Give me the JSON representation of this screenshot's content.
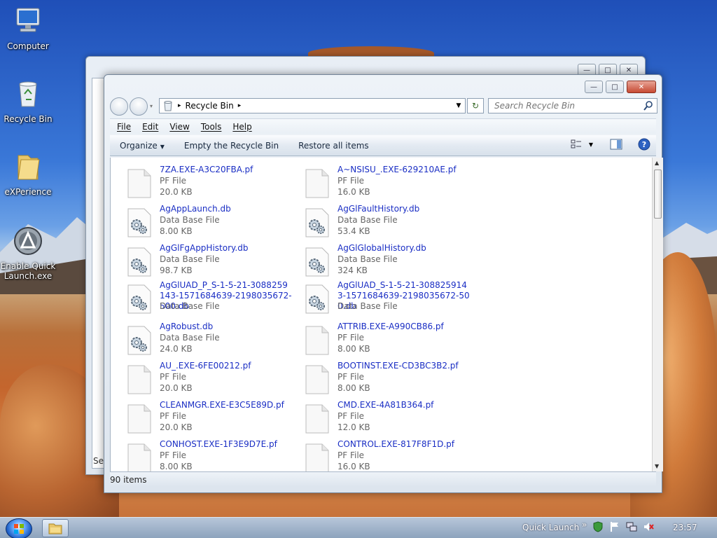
{
  "desktop": {
    "icons": [
      {
        "label": "Computer",
        "icon": "computer-icon"
      },
      {
        "label": "Recycle Bin",
        "icon": "recycle-bin-icon"
      },
      {
        "label": "eXPerience",
        "icon": "folder-icon"
      },
      {
        "label": "Enable Quick Launch.exe",
        "icon": "app-icon"
      }
    ]
  },
  "back_window": {
    "search_stub": "Sea"
  },
  "window": {
    "address": {
      "location": "Recycle Bin"
    },
    "search": {
      "placeholder": "Search Recycle Bin"
    },
    "menu": [
      "File",
      "Edit",
      "View",
      "Tools",
      "Help"
    ],
    "commands": {
      "organize": "Organize",
      "empty": "Empty the Recycle Bin",
      "restore": "Restore all items"
    },
    "status": "90 items",
    "files": [
      {
        "name": "7ZA.EXE-A3C20FBA.pf",
        "type": "PF File",
        "size": "20.0 KB",
        "kind": "pf"
      },
      {
        "name": "A~NSISU_.EXE-629210AE.pf",
        "type": "PF File",
        "size": "16.0 KB",
        "kind": "pf"
      },
      {
        "name": "AgAppLaunch.db",
        "type": "Data Base File",
        "size": "8.00 KB",
        "kind": "db"
      },
      {
        "name": "AgGlFaultHistory.db",
        "type": "Data Base File",
        "size": "53.4 KB",
        "kind": "db"
      },
      {
        "name": "AgGlFgAppHistory.db",
        "type": "Data Base File",
        "size": "98.7 KB",
        "kind": "db"
      },
      {
        "name": "AgGlGlobalHistory.db",
        "type": "Data Base File",
        "size": "324 KB",
        "kind": "db"
      },
      {
        "name": "AgGlUAD_P_S-1-5-21-3088259143-1571684639-2198035672-500.db",
        "type": "Data Base File",
        "size": "",
        "kind": "db"
      },
      {
        "name": "AgGlUAD_S-1-5-21-3088259143-1571684639-2198035672-500.db",
        "type": "Data Base File",
        "size": "",
        "kind": "db"
      },
      {
        "name": "AgRobust.db",
        "type": "Data Base File",
        "size": "24.0 KB",
        "kind": "db"
      },
      {
        "name": "ATTRIB.EXE-A990CB86.pf",
        "type": "PF File",
        "size": "8.00 KB",
        "kind": "pf"
      },
      {
        "name": "AU_.EXE-6FE00212.pf",
        "type": "PF File",
        "size": "20.0 KB",
        "kind": "pf"
      },
      {
        "name": "BOOTINST.EXE-CD3BC3B2.pf",
        "type": "PF File",
        "size": "8.00 KB",
        "kind": "pf"
      },
      {
        "name": "CLEANMGR.EXE-E3C5E89D.pf",
        "type": "PF File",
        "size": "20.0 KB",
        "kind": "pf"
      },
      {
        "name": "CMD.EXE-4A81B364.pf",
        "type": "PF File",
        "size": "12.0 KB",
        "kind": "pf"
      },
      {
        "name": "CONHOST.EXE-1F3E9D7E.pf",
        "type": "PF File",
        "size": "8.00 KB",
        "kind": "pf"
      },
      {
        "name": "CONTROL.EXE-817F8F1D.pf",
        "type": "PF File",
        "size": "16.0 KB",
        "kind": "pf"
      }
    ]
  },
  "taskbar": {
    "quick_launch": "Quick Launch",
    "chevron": "»",
    "clock": "23:57"
  }
}
